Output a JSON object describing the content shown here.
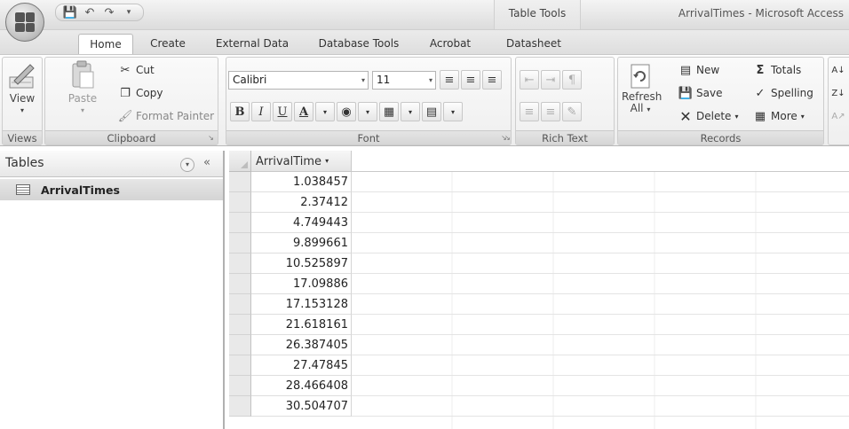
{
  "app": {
    "title": "ArrivalTimes - Microsoft Access",
    "context_tab_group": "Table Tools"
  },
  "quick_access": {
    "icons": [
      "save-icon",
      "undo-icon",
      "redo-icon",
      "customize-icon"
    ]
  },
  "tabs": [
    {
      "label": "Home",
      "active": true
    },
    {
      "label": "Create",
      "active": false
    },
    {
      "label": "External Data",
      "active": false
    },
    {
      "label": "Database Tools",
      "active": false
    },
    {
      "label": "Acrobat",
      "active": false
    },
    {
      "label": "Datasheet",
      "active": false
    }
  ],
  "ribbon": {
    "views": {
      "label": "Views",
      "view_button": "View"
    },
    "clipboard": {
      "label": "Clipboard",
      "paste": "Paste",
      "cut": "Cut",
      "copy": "Copy",
      "format_painter": "Format Painter"
    },
    "font": {
      "label": "Font",
      "font_name": "Calibri",
      "font_size": "11",
      "bold": "B",
      "italic": "I",
      "underline": "U",
      "font_color": "A"
    },
    "rich_text": {
      "label": "Rich Text"
    },
    "records": {
      "label": "Records",
      "refresh": "Refresh",
      "refresh_sub": "All",
      "new": "New",
      "save": "Save",
      "delete": "Delete",
      "totals": "Totals",
      "spelling": "Spelling",
      "more": "More"
    }
  },
  "nav_pane": {
    "title": "Tables",
    "items": [
      {
        "label": "ArrivalTimes",
        "icon": "table-icon",
        "selected": true
      }
    ]
  },
  "datasheet": {
    "column_header": "ArrivalTime",
    "rows": [
      "1.038457",
      "2.37412",
      "4.749443",
      "9.899661",
      "10.525897",
      "17.09886",
      "17.153128",
      "21.618161",
      "26.387405",
      "27.47845",
      "28.466408",
      "30.504707"
    ]
  }
}
